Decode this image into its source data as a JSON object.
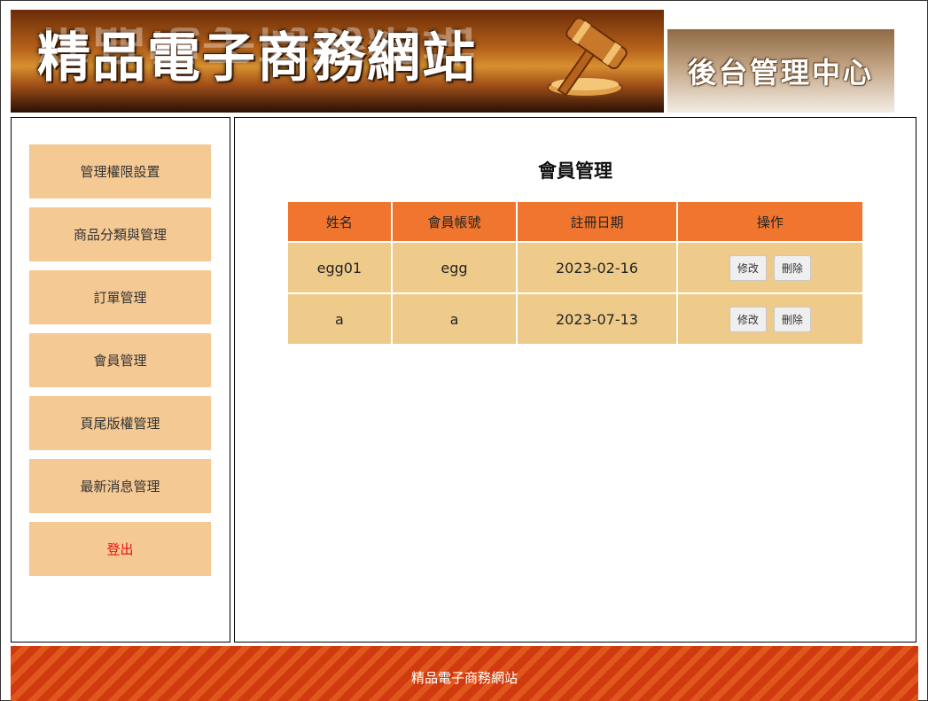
{
  "header": {
    "site_title": "精品電子商務網站",
    "admin_center": "後台管理中心"
  },
  "sidebar": {
    "items": [
      {
        "label": "管理權限設置"
      },
      {
        "label": "商品分類與管理"
      },
      {
        "label": "訂單管理"
      },
      {
        "label": "會員管理"
      },
      {
        "label": "頁尾版權管理"
      },
      {
        "label": "最新消息管理"
      },
      {
        "label": "登出"
      }
    ]
  },
  "main": {
    "title": "會員管理",
    "table": {
      "headers": [
        "姓名",
        "會員帳號",
        "註冊日期",
        "操作"
      ],
      "rows": [
        {
          "name": "egg01",
          "account": "egg",
          "date": "2023-02-16",
          "edit": "修改",
          "delete": "刪除"
        },
        {
          "name": "a",
          "account": "a",
          "date": "2023-07-13",
          "edit": "修改",
          "delete": "刪除"
        }
      ]
    }
  },
  "footer": {
    "text": "精品電子商務網站"
  },
  "colors": {
    "nav_bg": "#f5c993",
    "table_header_bg": "#f07630",
    "table_row_bg": "#eecb8b",
    "logout_text": "#ee1111",
    "footer_stripe_a": "#cf3a0e",
    "footer_stripe_b": "#e0571e"
  },
  "icons": {
    "banner_icon": "gavel-icon"
  }
}
